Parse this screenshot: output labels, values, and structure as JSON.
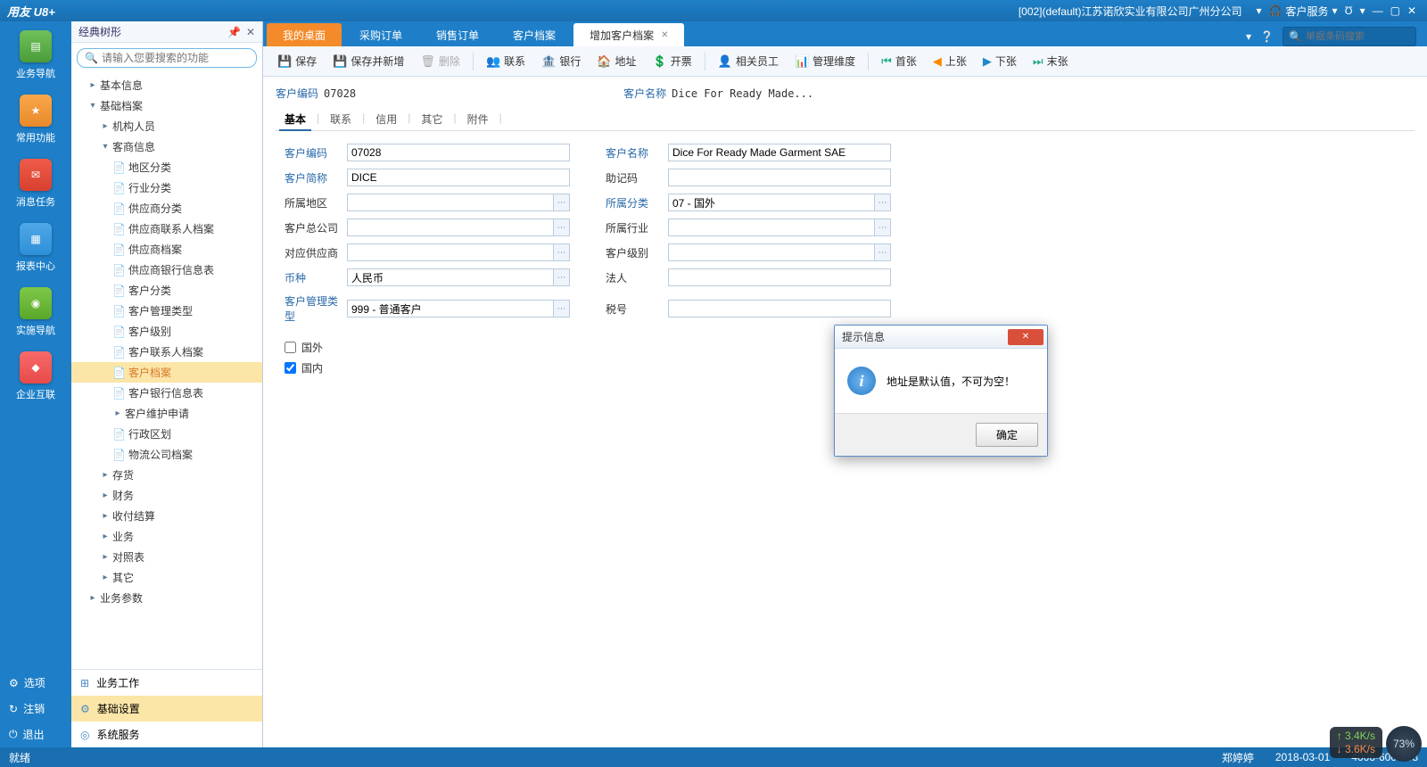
{
  "titlebar": {
    "logo": "用友 U8+",
    "company": "[002](default)江苏诺欣实业有限公司广州分公司",
    "service": "客户服务"
  },
  "leftnav": {
    "items": [
      {
        "label": "业务导航",
        "glyph": "▤"
      },
      {
        "label": "常用功能",
        "glyph": "★"
      },
      {
        "label": "消息任务",
        "glyph": "✉"
      },
      {
        "label": "报表中心",
        "glyph": "▦"
      },
      {
        "label": "实施导航",
        "glyph": "◉"
      },
      {
        "label": "企业互联",
        "glyph": "◆"
      }
    ],
    "bottom": [
      {
        "label": "选项",
        "ico": "⚙"
      },
      {
        "label": "注销",
        "ico": "↻"
      },
      {
        "label": "退出",
        "ico": "⏻"
      }
    ]
  },
  "tree": {
    "title": "经典树形",
    "search_placeholder": "请输入您要搜索的功能",
    "nodes": [
      {
        "label": "基本信息",
        "indent": 1,
        "chev": "▸"
      },
      {
        "label": "基础档案",
        "indent": 1,
        "chev": "▾"
      },
      {
        "label": "机构人员",
        "indent": 2,
        "chev": "▸"
      },
      {
        "label": "客商信息",
        "indent": 2,
        "chev": "▾"
      },
      {
        "label": "地区分类",
        "indent": 3,
        "doc": true
      },
      {
        "label": "行业分类",
        "indent": 3,
        "doc": true
      },
      {
        "label": "供应商分类",
        "indent": 3,
        "doc": true
      },
      {
        "label": "供应商联系人档案",
        "indent": 3,
        "doc": true
      },
      {
        "label": "供应商档案",
        "indent": 3,
        "doc": true
      },
      {
        "label": "供应商银行信息表",
        "indent": 3,
        "doc": true
      },
      {
        "label": "客户分类",
        "indent": 3,
        "doc": true
      },
      {
        "label": "客户管理类型",
        "indent": 3,
        "doc": true
      },
      {
        "label": "客户级别",
        "indent": 3,
        "doc": true
      },
      {
        "label": "客户联系人档案",
        "indent": 3,
        "doc": true
      },
      {
        "label": "客户档案",
        "indent": 3,
        "doc": true,
        "active": true,
        "orange": true
      },
      {
        "label": "客户银行信息表",
        "indent": 3,
        "doc": true
      },
      {
        "label": "客户维护申请",
        "indent": 3,
        "chev": "▸"
      },
      {
        "label": "行政区划",
        "indent": 3,
        "doc": true
      },
      {
        "label": "物流公司档案",
        "indent": 3,
        "doc": true
      },
      {
        "label": "存货",
        "indent": 2,
        "chev": "▸"
      },
      {
        "label": "财务",
        "indent": 2,
        "chev": "▸"
      },
      {
        "label": "收付结算",
        "indent": 2,
        "chev": "▸"
      },
      {
        "label": "业务",
        "indent": 2,
        "chev": "▸"
      },
      {
        "label": "对照表",
        "indent": 2,
        "chev": "▸"
      },
      {
        "label": "其它",
        "indent": 2,
        "chev": "▸"
      },
      {
        "label": "业务参数",
        "indent": 1,
        "chev": "▸"
      }
    ],
    "foot": [
      {
        "label": "业务工作",
        "ico": "⊞",
        "active": false
      },
      {
        "label": "基础设置",
        "ico": "⚙",
        "active": true
      },
      {
        "label": "系统服务",
        "ico": "◎",
        "active": false
      }
    ]
  },
  "tabs": {
    "items": [
      {
        "label": "我的桌面",
        "orange": true
      },
      {
        "label": "采购订单"
      },
      {
        "label": "销售订单"
      },
      {
        "label": "客户档案"
      },
      {
        "label": "增加客户档案",
        "active": true,
        "closable": true
      }
    ],
    "barcode_placeholder": "单据条码搜索"
  },
  "toolbar": {
    "save": "保存",
    "save_add": "保存并新增",
    "delete": "删除",
    "contact": "联系",
    "bank": "银行",
    "address": "地址",
    "invoice": "开票",
    "staff": "相关员工",
    "mgmt": "管理维度",
    "first": "首张",
    "prev": "上张",
    "next": "下张",
    "last": "末张"
  },
  "info": {
    "code_label": "客户编码",
    "code_value": "07028",
    "name_label": "客户名称",
    "name_value": "Dice For Ready Made..."
  },
  "subtabs": [
    "基本",
    "联系",
    "信用",
    "其它",
    "附件"
  ],
  "form": {
    "l_code": "客户编码",
    "v_code": "07028",
    "l_name": "客户名称",
    "v_name": "Dice For Ready Made Garment SAE",
    "l_short": "客户简称",
    "v_short": "DICE",
    "l_mnem": "助记码",
    "v_mnem": "",
    "l_region": "所属地区",
    "v_region": "",
    "l_class": "所属分类",
    "v_class": "07 - 国外",
    "l_hq": "客户总公司",
    "v_hq": "",
    "l_industry": "所属行业",
    "v_industry": "",
    "l_supplier": "对应供应商",
    "v_supplier": "",
    "l_level": "客户级别",
    "v_level": "",
    "l_curr": "币种",
    "v_curr": "人民币",
    "l_legal": "法人",
    "v_legal": "",
    "l_mgtype": "客户管理类型",
    "v_mgtype": "999 - 普通客户",
    "l_tax": "税号",
    "v_tax": "",
    "chk_foreign": "国外",
    "chk_domestic": "国内"
  },
  "dialog": {
    "title": "提示信息",
    "msg": "地址是默认值，不可为空！",
    "ok": "确定"
  },
  "status": {
    "ready": "就绪",
    "user": "郑婷婷",
    "date": "2018-03-01",
    "phone": "4006-600-588",
    "net_up": "3.4K/s",
    "net_dn": "3.6K/s",
    "battery": "73%"
  }
}
